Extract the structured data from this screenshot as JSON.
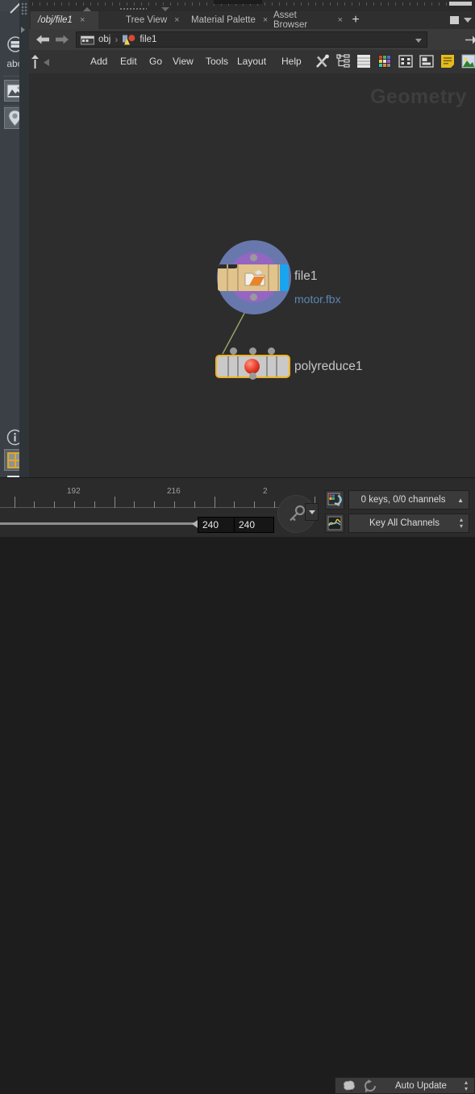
{
  "app": {
    "context_watermark": "Geometry"
  },
  "tabs": {
    "items": [
      {
        "label": "/obj/file1",
        "close": "×",
        "active": true
      },
      {
        "label": "Tree View",
        "close": "×",
        "active": false
      },
      {
        "label": "Material Palette",
        "close": "×",
        "active": false
      },
      {
        "label": "Asset Browser",
        "close": "×",
        "active": false
      }
    ],
    "add_tab": "+",
    "maximize_icon": "maximize-pane-icon",
    "menu_icon": "pane-menu-icon"
  },
  "pathbar": {
    "back_icon": "back-arrow-icon",
    "forward_icon": "forward-arrow-icon",
    "crumbs": [
      {
        "icon": "obj-context-icon",
        "label": "obj"
      },
      {
        "icon": "geometry-node-icon",
        "label": "file1"
      }
    ],
    "separator": "›",
    "dropdown_icon": "chevron-down-icon",
    "pin_icon": "pin-pane-icon",
    "target_icon": "target-icon"
  },
  "menubar": {
    "items": [
      "Add",
      "Edit",
      "Go",
      "View",
      "Tools",
      "Layout",
      "Help"
    ],
    "tools": [
      "tools-wrench-icon",
      "node-tree-icon",
      "list-view-icon",
      "color-palette-icon",
      "layout-grid-icon",
      "snapshot-icon",
      "notes-icon",
      "image-icon",
      "overflow-arrow-icon"
    ],
    "collapse_icon": "collapse-left-icon",
    "scroll_up_icon": "scroll-up-icon"
  },
  "network": {
    "nodes": [
      {
        "name": "file1",
        "subtitle": "motor.fbx",
        "icon": "file-node-icon",
        "selected": false
      },
      {
        "name": "polyreduce1",
        "subtitle": "",
        "icon": "polyreduce-node-icon",
        "selected": true
      }
    ]
  },
  "playbar": {
    "ruler": {
      "labels": [
        "192",
        "216",
        "2"
      ],
      "label_positions": [
        92,
        216,
        335
      ],
      "tick_spacing": 24.8
    },
    "current_frame": "240",
    "end_frame": "240",
    "key_button_icon": "set-key-icon",
    "key_dropdown_icon": "chevron-down-icon",
    "channel_button_icon": "channel-list-icon",
    "channel_status": "0 keys, 0/0 channels",
    "channel_status_caret": "▲",
    "animation_button_icon": "animation-editor-icon",
    "key_mode": "Key All Channels",
    "key_mode_caret": "▴▾"
  },
  "statusbar": {
    "brain_icon": "cook-brain-icon",
    "refresh_icon": "refresh-icon",
    "update_mode": "Auto Update",
    "update_caret": "▴▾"
  },
  "left_rail": {
    "top_items": [
      {
        "icon": "display-options-icon",
        "label": "",
        "selected": false
      },
      {
        "icon": "abc-text-icon",
        "label": "abc",
        "selected": false
      },
      {
        "icon": "image-viewer-icon",
        "label": "",
        "selected": true
      },
      {
        "icon": "pin-marker-icon",
        "label": "",
        "selected": true
      }
    ],
    "bottom_items": [
      {
        "icon": "info-icon",
        "label": "",
        "selected": false
      },
      {
        "icon": "grid-layout-icon",
        "label": "",
        "selected": true
      },
      {
        "icon": "eye-visibility-icon",
        "label": "",
        "selected": false
      }
    ]
  },
  "colors": {
    "accent_selected": "#f0b323",
    "link_text": "#5d86b4",
    "panel_bg": "#2d2d2d",
    "rail_bg": "#3a4046"
  }
}
